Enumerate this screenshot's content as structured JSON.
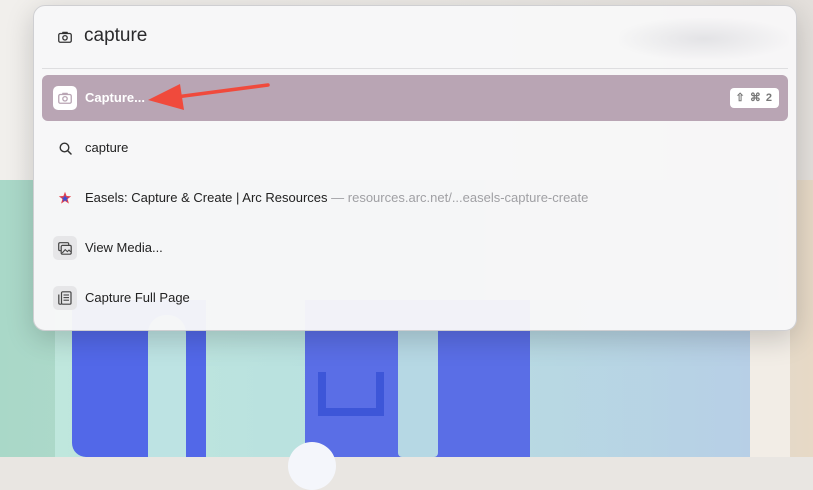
{
  "search": {
    "query": "capture",
    "icon": "camera-icon"
  },
  "results": [
    {
      "label": "Capture...",
      "icon": "camera-icon",
      "shortcut": "⇧ ⌘ 2",
      "selected": true
    },
    {
      "label": "capture",
      "icon": "search-icon"
    },
    {
      "label": "Easels: Capture & Create | Arc Resources",
      "sub": " — resources.arc.net/...easels-capture-create",
      "icon": "arc-star-icon"
    },
    {
      "label": "View Media...",
      "icon": "media-icon"
    },
    {
      "label": "Capture Full Page",
      "icon": "full-page-icon"
    }
  ],
  "colors": {
    "selected_row": "#b9a5b4",
    "annotation_arrow": "#f04a3c"
  }
}
